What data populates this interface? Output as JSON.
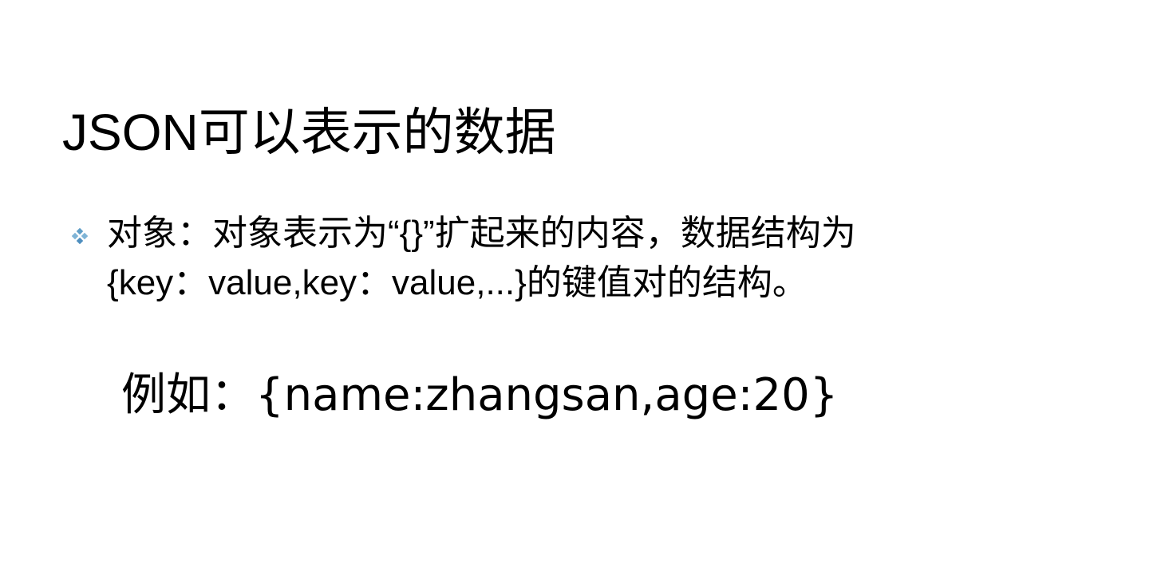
{
  "slide": {
    "title": "JSON可以表示的数据",
    "bullet": {
      "icon": "diamond-bullet-icon",
      "color": "#5f9ec7",
      "line1": "对象：对象表示为“{}”扩起来的内容，数据结构为",
      "line2": "{key：value,key：value,...}的键值对的结构。"
    },
    "example": "例如：{name:zhangsan,age:20}"
  }
}
